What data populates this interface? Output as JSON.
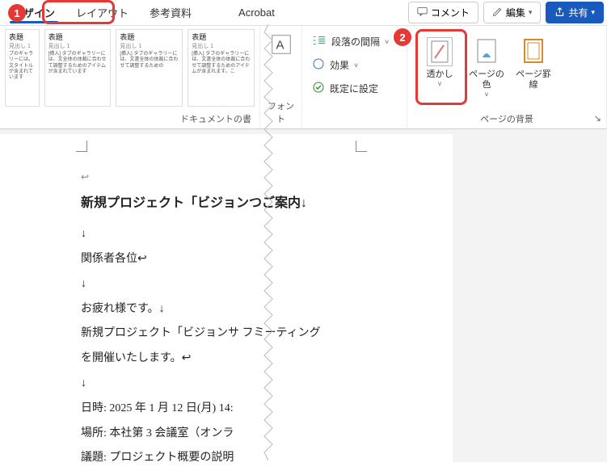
{
  "tabs": {
    "design": "デザイン",
    "layout": "レイアウト",
    "reference": "参考資料",
    "acrobat": "Acrobat"
  },
  "topright": {
    "comment": "コメント",
    "edit": "編集",
    "share": "共有"
  },
  "themes": [
    {
      "title": "表題",
      "sub": "見出し 1",
      "body": "プのギャラリーには。文タイトルが含まれています"
    },
    {
      "title": "表題",
      "sub": "見出し 1",
      "body": "[挿入] タブのギャラリーには、文全体の体裁に合わせて調整するためのアイテムが含まれています"
    },
    {
      "title": "表題",
      "sub": "見出し 1",
      "body": "[挿入] タブのギャラリーには、文書全体の体裁に合わせて調整するための"
    },
    {
      "title": "表題",
      "sub": "見出し 1",
      "body": "[挿入] タブのギャラリーには、文書全体の体裁に合わせて調整するためのアイテムが含まれます。こ"
    }
  ],
  "ribbon_labels": {
    "doc_format": "ドキュメントの書",
    "font": "フォント",
    "page_bg": "ページの背景"
  },
  "para": {
    "spacing": "段落の間隔",
    "effect": "効果",
    "set_default": "既定に設定"
  },
  "page_bg": {
    "watermark": "透かし",
    "page_color": "ページの色",
    "borders": "ページ罫線"
  },
  "callouts": {
    "one": "1",
    "two": "2"
  },
  "doc": {
    "title": "新規プロジェクト「ビジョンつご案内↓",
    "lines": [
      "↓",
      "関係者各位↩",
      "↓",
      "お疲れ様です。↓",
      "新規プロジェクト「ビジョンサ    フミーティング",
      "を開催いたします。↩",
      "↓",
      "日時: 2025 年 1 月 12 日(月) 14:",
      "場所: 本社第 3 会議室（オンラ",
      "議題: プロジェクト概要の説明"
    ]
  }
}
